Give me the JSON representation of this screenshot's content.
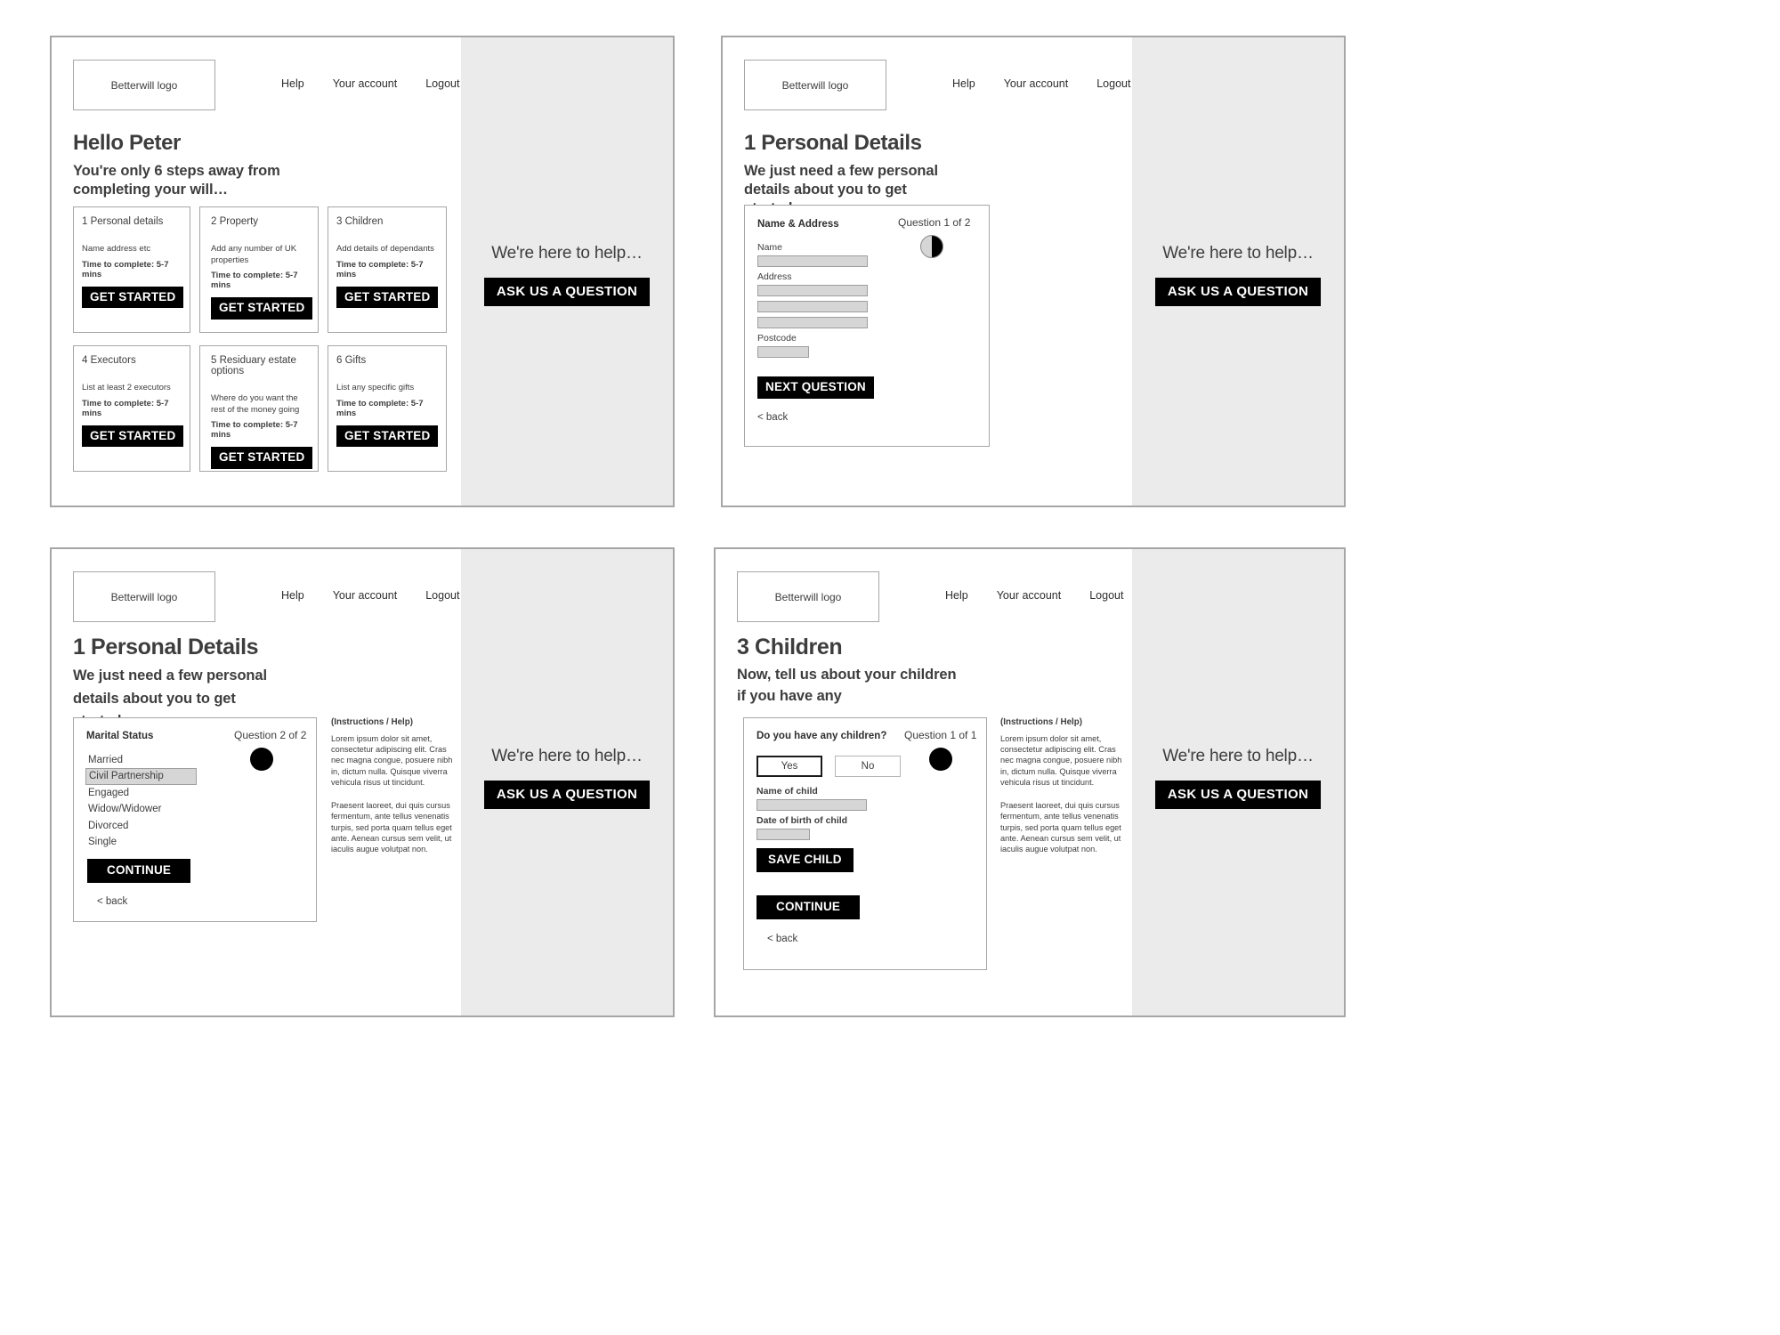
{
  "brand": {
    "logo_text": "Betterwill logo"
  },
  "nav": {
    "items": [
      "Help",
      "Your account",
      "Logout"
    ]
  },
  "aside": {
    "heading": "We're here to help…",
    "button_label": "ASK US A QUESTION"
  },
  "common": {
    "back_label": "< back",
    "instructions_title": "(Instructions / Help)",
    "instructions_p1": "Lorem ipsum dolor sit amet, consectetur adipiscing elit. Cras nec magna congue, posuere nibh in, dictum nulla. Quisque viverra vehicula risus ut tincidunt.",
    "instructions_p2": "Praesent laoreet, dui quis cursus fermentum, ante tellus venenatis turpis, sed porta quam tellus eget ante. Aenean cursus sem velit, ut iaculis augue volutpat non."
  },
  "screen1": {
    "title": "Hello Peter",
    "subtitle_pre": "You're only ",
    "subtitle_count": "6",
    "subtitle_post": " steps away from completing your will…",
    "cards": [
      {
        "title": "1 Personal details",
        "desc": "Name address etc",
        "time": "Time to complete: 5-7 mins",
        "button": "GET STARTED"
      },
      {
        "title": "2 Property",
        "desc": "Add any number of UK properties",
        "time": "Time to complete: 5-7 mins",
        "button": "GET STARTED"
      },
      {
        "title": "3 Children",
        "desc": "Add details of dependants",
        "time": "Time to complete: 5-7 mins",
        "button": "GET STARTED"
      },
      {
        "title": "4 Executors",
        "desc": "List at least 2 executors",
        "time": "Time to complete: 5-7 mins",
        "button": "GET STARTED"
      },
      {
        "title": "5 Residuary estate options",
        "desc": "Where do you want the rest of the money going",
        "time": "Time to complete: 5-7 mins",
        "button": "GET STARTED"
      },
      {
        "title": "6 Gifts",
        "desc": "List any specific gifts",
        "time": "Time to complete: 5-7 mins",
        "button": "GET STARTED"
      }
    ]
  },
  "screen2": {
    "title": "1 Personal Details",
    "subtitle": "We just need a few personal details about you to get started…",
    "form_title": "Name & Address",
    "question_counter": "Question 1 of  2",
    "progress_style": "half",
    "label_name": "Name",
    "label_address": "Address",
    "label_postcode": "Postcode",
    "submit_label": "NEXT QUESTION"
  },
  "screen3": {
    "title": "1 Personal Details",
    "subtitle": "We just need a few personal details about you to get started…",
    "form_title": "Marital Status",
    "question_counter": "Question 2 of  2",
    "progress_style": "full",
    "options": [
      "Married",
      "Civil Partnership",
      "Engaged",
      "Widow/Widower",
      "Divorced",
      "Single"
    ],
    "selected_option": "Civil Partnership",
    "submit_label": "CONTINUE"
  },
  "screen4": {
    "title": "3 Children",
    "subtitle": "Now, tell us about your children if you have any",
    "form_title": "Do you have any children?",
    "question_counter": "Question 1 of  1",
    "progress_style": "full",
    "yes_label": "Yes",
    "no_label": "No",
    "selected_answer": "Yes",
    "label_child_name": "Name of child",
    "label_child_dob": "Date of birth of child",
    "save_label": "SAVE CHILD",
    "submit_label": "CONTINUE"
  },
  "colors": {
    "frame_border": "#a6a6a6",
    "aside_bg": "#ebebeb",
    "accent": "#000000",
    "input_fill": "#d6d6d6"
  }
}
